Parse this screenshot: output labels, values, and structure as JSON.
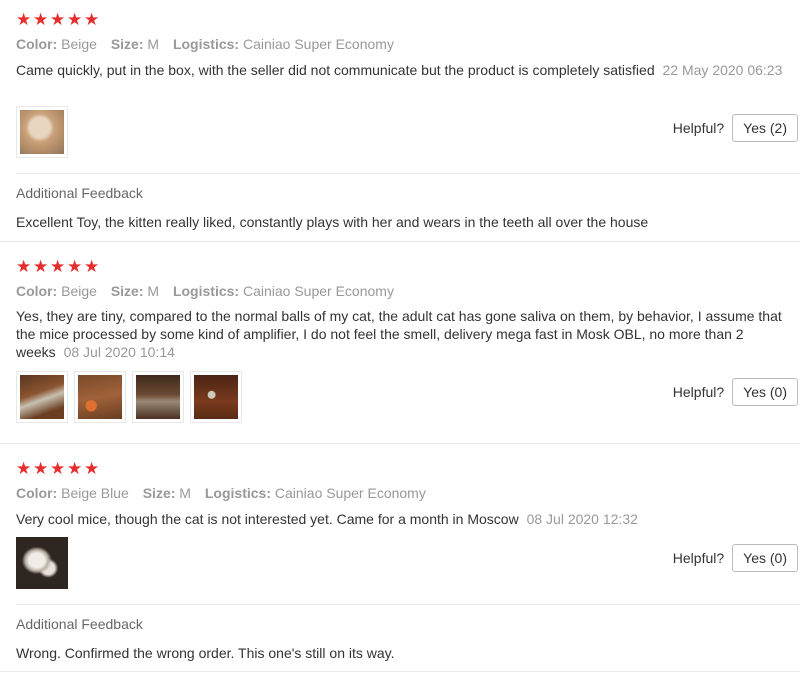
{
  "labels": {
    "color": "Color:",
    "size": "Size:",
    "logistics": "Logistics:",
    "helpful": "Helpful?",
    "additional_feedback": "Additional Feedback"
  },
  "star_glyph": "★",
  "reviews": [
    {
      "rating": 5,
      "color": "Beige",
      "size": "M",
      "logistics": "Cainiao Super Economy",
      "text": "Came quickly, put in the box, with the seller did not communicate but the product is completely satisfied",
      "date": "22 May 2020 06:23",
      "helpful_button": "Yes (2)",
      "additional_feedback": "Excellent Toy, the kitten really liked, constantly plays with her and wears in the teeth all over the house",
      "photo_colors": [
        "#c9a27a"
      ]
    },
    {
      "rating": 5,
      "color": "Beige",
      "size": "M",
      "logistics": "Cainiao Super Economy",
      "text": "Yes, they are tiny, compared to the normal balls of my cat, the adult cat has gone saliva on them, by behavior, I assume that the mice processed by some kind of amplifier, I do not feel the smell, delivery mega fast in Mosk OBL, no more than 2 weeks",
      "date": "08 Jul 2020 10:14",
      "helpful_button": "Yes (0)",
      "photo_colors": [
        "#7a4a2a",
        "#8a5430",
        "#5e3a22",
        "#6b2e1a"
      ]
    },
    {
      "rating": 5,
      "color": "Beige Blue",
      "size": "M",
      "logistics": "Cainiao Super Economy",
      "text": "Very cool mice, though the cat is not interested yet. Came for a month in Moscow",
      "date": "08 Jul 2020 12:32",
      "helpful_button": "Yes (0)",
      "additional_feedback": "Wrong. Confirmed the wrong order. This one's still on its way.",
      "photo_colors": [
        "#3a3028"
      ]
    }
  ]
}
